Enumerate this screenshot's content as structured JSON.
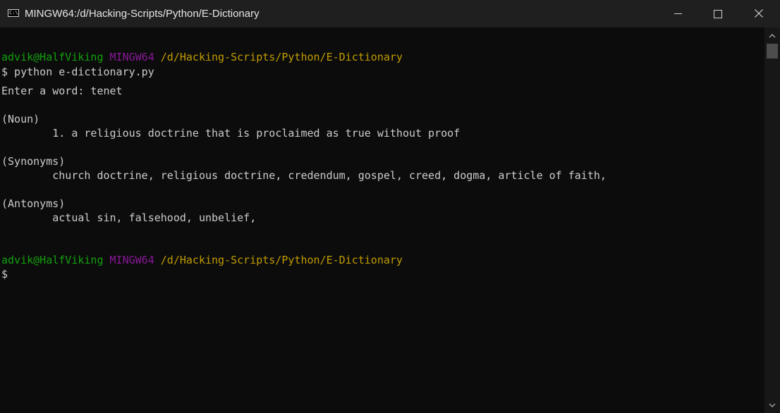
{
  "window": {
    "title": "MINGW64:/d/Hacking-Scripts/Python/E-Dictionary",
    "app_icon_text": "C:\\",
    "icons": {
      "app": "terminal-app-icon",
      "minimize": "minimize-icon",
      "maximize": "maximize-icon",
      "close": "close-icon"
    }
  },
  "theme": {
    "background": "#0c0c0c",
    "text": "#cccccc",
    "user": "#13a10e",
    "shell": "#881798",
    "path": "#c19c00"
  },
  "terminal": {
    "prompt1": {
      "user": "advik@HalfViking",
      "shell": "MINGW64",
      "path": "/d/Hacking-Scripts/Python/E-Dictionary"
    },
    "command": "$ python e-dictionary.py",
    "input_line": "Enter a word: tenet",
    "noun_header": "(Noun)",
    "noun_def": "        1. a religious doctrine that is proclaimed as true without proof",
    "synonyms_header": "(Synonyms)",
    "synonyms_list": "        church doctrine, religious doctrine, credendum, gospel, creed, dogma, article of faith,",
    "antonyms_header": "(Antonyms)",
    "antonyms_list": "        actual sin, falsehood, unbelief,",
    "prompt2": {
      "user": "advik@HalfViking",
      "shell": "MINGW64",
      "path": "/d/Hacking-Scripts/Python/E-Dictionary"
    },
    "final_prompt": "$"
  }
}
